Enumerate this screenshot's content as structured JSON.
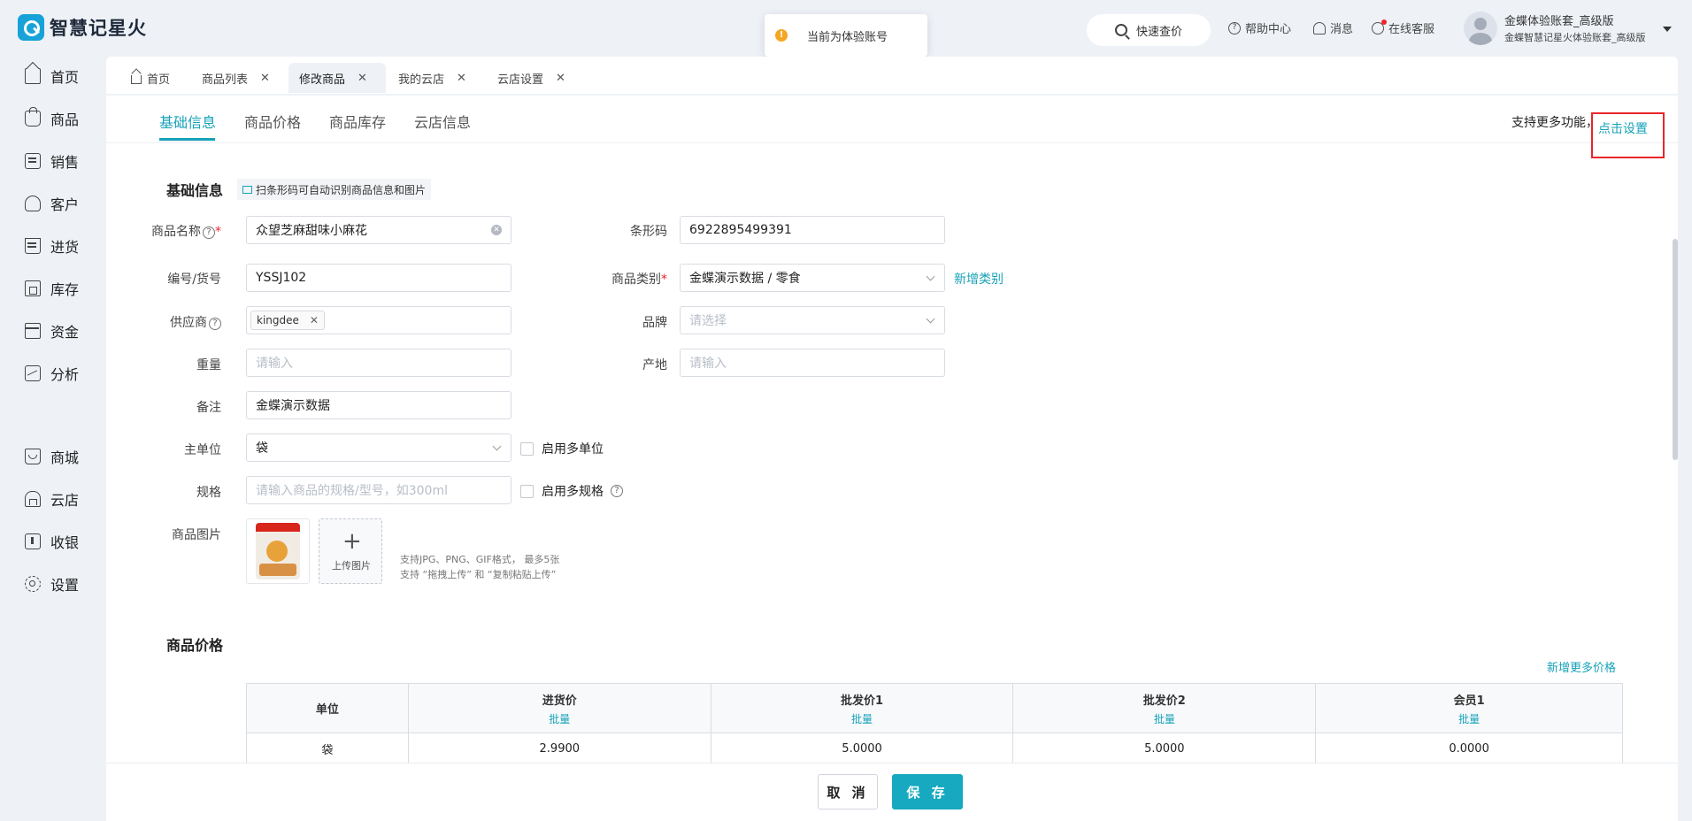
{
  "app": {
    "title": "智慧记星火"
  },
  "toast": {
    "text": "当前为体验账号"
  },
  "header": {
    "quick_search": "快速查价",
    "help": "帮助中心",
    "messages": "消息",
    "service": "在线客服",
    "user_name": "金蝶体验账套_高级版",
    "user_sub": "金蝶智慧记星火体验账套_高级版"
  },
  "sidebar": {
    "items": [
      {
        "label": "首页",
        "icon": "home-icon"
      },
      {
        "label": "商品",
        "icon": "bag-icon"
      },
      {
        "label": "销售",
        "icon": "clipboard-icon"
      },
      {
        "label": "客户",
        "icon": "user-icon"
      },
      {
        "label": "进货",
        "icon": "purchase-icon"
      },
      {
        "label": "库存",
        "icon": "warehouse-icon"
      },
      {
        "label": "资金",
        "icon": "wallet-icon"
      },
      {
        "label": "分析",
        "icon": "chart-icon"
      },
      {
        "label": "商城",
        "icon": "mall-icon"
      },
      {
        "label": "云店",
        "icon": "cloud-shop-icon"
      },
      {
        "label": "收银",
        "icon": "cashier-icon"
      },
      {
        "label": "设置",
        "icon": "gear-icon"
      }
    ]
  },
  "tabs": [
    {
      "label": "首页"
    },
    {
      "label": "商品列表"
    },
    {
      "label": "修改商品"
    },
    {
      "label": "我的云店"
    },
    {
      "label": "云店设置"
    }
  ],
  "subtabs": [
    {
      "label": "基础信息"
    },
    {
      "label": "商品价格"
    },
    {
      "label": "商品库存"
    },
    {
      "label": "云店信息"
    }
  ],
  "more": {
    "text": "支持更多功能，",
    "link": "点击设置"
  },
  "basic": {
    "title": "基础信息",
    "scan_tip": "扫条形码可自动识别商品信息和图片",
    "name_label": "商品名称",
    "name_value": "众望芝麻甜味小麻花",
    "barcode_label": "条形码",
    "barcode_value": "6922895499391",
    "code_label": "编号/货号",
    "code_value": "YSSJ102",
    "category_label": "商品类别",
    "category_value": "金蝶演示数据 / 零食",
    "add_category": "新增类别",
    "supplier_label": "供应商",
    "supplier_tag": "kingdee",
    "brand_label": "品牌",
    "brand_placeholder": "请选择",
    "weight_label": "重量",
    "weight_placeholder": "请输入",
    "origin_label": "产地",
    "origin_placeholder": "请输入",
    "remark_label": "备注",
    "remark_value": "金蝶演示数据",
    "unit_label": "主单位",
    "unit_value": "袋",
    "multi_unit": "启用多单位",
    "spec_label": "规格",
    "spec_placeholder": "请输入商品的规格/型号，如300ml",
    "multi_spec": "启用多规格",
    "image_label": "商品图片",
    "upload_label": "上传图片",
    "hint1": "支持JPG、PNG、GIF格式， 最多5张",
    "hint2": "支持 “拖拽上传” 和 “复制粘贴上传”"
  },
  "price": {
    "title": "商品价格",
    "add_more": "新增更多价格",
    "headers": [
      "单位",
      "进货价",
      "批发价1",
      "批发价2",
      "会员1"
    ],
    "batch": "批量",
    "rows": [
      [
        "袋",
        "2.9900",
        "5.0000",
        "5.0000",
        "0.0000"
      ]
    ]
  },
  "buttons": {
    "cancel": "取 消",
    "save": "保 存"
  }
}
